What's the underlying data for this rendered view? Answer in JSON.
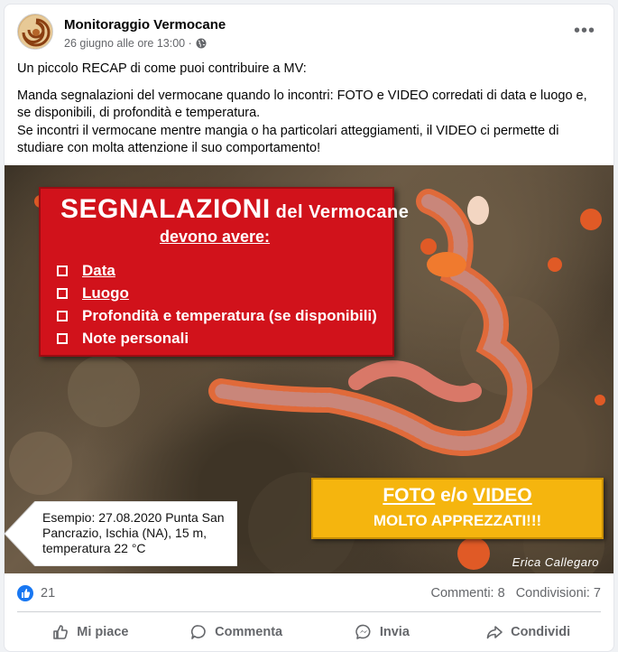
{
  "post": {
    "page_name": "Monitoraggio Vermocane",
    "timestamp": "26 giugno alle ore 13:00 ·",
    "audience_icon": "globe-icon",
    "more_icon": "more-options-icon",
    "paragraph1": "Un piccolo RECAP di come puoi contribuire a MV:",
    "paragraph2": "Manda segnalazioni del vermocane quando lo incontri: FOTO e VIDEO corredati di data e luogo e, se disponibili, di profondità e temperatura.",
    "paragraph3": "Se incontri il vermocane mentre mangia o ha particolari atteggiamenti, il VIDEO ci permette di studiare con molta attenzione il suo comportamento!"
  },
  "image": {
    "red_box": {
      "title": "SEGNALAZIONI",
      "title_rest": "del Vermocane",
      "subtitle": "devono avere:",
      "items": [
        "Data",
        "Luogo",
        "Profondità e temperatura (se disponibili)",
        "Note personali"
      ],
      "color": "#d1121b"
    },
    "callout": "Esempio: 27.08.2020 Punta San Pancrazio, Ischia (NA), 15 m, temperatura 22 °C",
    "yellow_box": {
      "foto": "FOTO",
      "mid": " e/o ",
      "video": "VIDEO",
      "line2": "MOLTO APPREZZATI!!!",
      "color": "#f5b50e"
    },
    "credit": "Erica Callegaro"
  },
  "stats": {
    "reactions": "21",
    "comments": "Commenti: 8",
    "shares": "Condivisioni: 7"
  },
  "actions": {
    "like": "Mi piace",
    "comment": "Commenta",
    "send": "Invia",
    "share": "Condividi"
  }
}
